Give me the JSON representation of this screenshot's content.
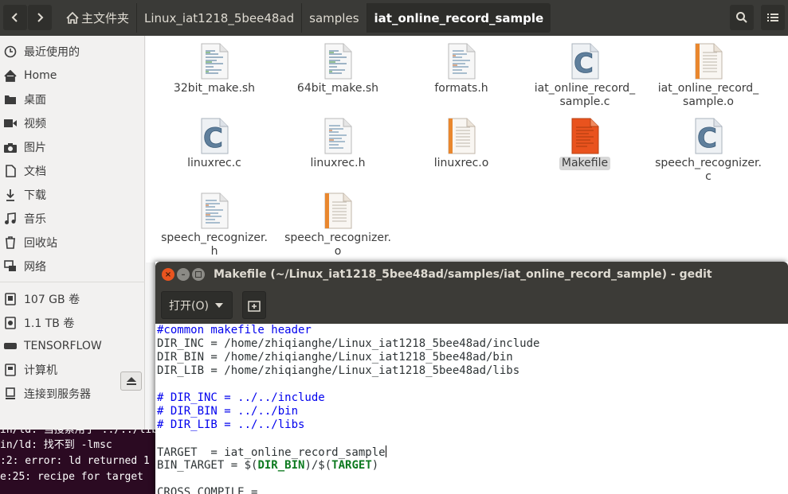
{
  "header": {
    "breadcrumbs": [
      {
        "label": "主文件夹"
      },
      {
        "label": "Linux_iat1218_5bee48ad"
      },
      {
        "label": "samples"
      },
      {
        "label": "iat_online_record_sample"
      }
    ]
  },
  "sidebar": {
    "items": [
      {
        "label": "最近使用的"
      },
      {
        "label": "Home"
      },
      {
        "label": "桌面"
      },
      {
        "label": "视频"
      },
      {
        "label": "图片"
      },
      {
        "label": "文档"
      },
      {
        "label": "下载"
      },
      {
        "label": "音乐"
      },
      {
        "label": "回收站"
      },
      {
        "label": "网络"
      }
    ],
    "devices": [
      {
        "label": "107 GB 卷"
      },
      {
        "label": "1.1 TB 卷"
      },
      {
        "label": "TENSORFLOW"
      },
      {
        "label": "计算机"
      },
      {
        "label": "连接到服务器"
      }
    ]
  },
  "files": [
    {
      "name": "32bit_make.sh",
      "type": "script"
    },
    {
      "name": "64bit_make.sh",
      "type": "script"
    },
    {
      "name": "formats.h",
      "type": "header"
    },
    {
      "name": "iat_online_record_\nsample.c",
      "type": "c"
    },
    {
      "name": "iat_online_record_\nsample.o",
      "type": "object"
    },
    {
      "name": "linuxrec.c",
      "type": "c"
    },
    {
      "name": "linuxrec.h",
      "type": "header"
    },
    {
      "name": "linuxrec.o",
      "type": "object"
    },
    {
      "name": "Makefile",
      "type": "makefile",
      "selected": true
    },
    {
      "name": "speech_recognizer.\nc",
      "type": "c"
    },
    {
      "name": "speech_recognizer.\nh",
      "type": "header"
    },
    {
      "name": "speech_recognizer.\no",
      "type": "object"
    }
  ],
  "terminal": {
    "lines": [
      "in/ld: 当搜索用于 ../../lib",
      "in/ld: 找不到 -lmsc",
      ":2: error: ld returned 1",
      "e:25: recipe for target"
    ]
  },
  "gedit": {
    "title": "Makefile (~/Linux_iat1218_5bee48ad/samples/iat_online_record_sample) - gedit",
    "open_label": "打开(O)",
    "lines": [
      {
        "text": "#common makefile header",
        "comment": true
      },
      {
        "text": "DIR_INC = /home/zhiqianghe/Linux_iat1218_5bee48ad/include"
      },
      {
        "text": "DIR_BIN = /home/zhiqianghe/Linux_iat1218_5bee48ad/bin"
      },
      {
        "text": "DIR_LIB = /home/zhiqianghe/Linux_iat1218_5bee48ad/libs"
      },
      {
        "text": ""
      },
      {
        "text": "# DIR_INC = ../../include",
        "comment": true
      },
      {
        "text": "# DIR_BIN = ../../bin",
        "comment": true
      },
      {
        "text": "# DIR_LIB = ../../libs",
        "comment": true
      },
      {
        "text": ""
      },
      {
        "text": "TARGET  = iat_online_record_sample",
        "cursor": true
      },
      {
        "text": "BIN_TARGET = $(DIR_BIN)/$(TARGET)",
        "vars": [
          "DIR_BIN",
          "TARGET"
        ]
      },
      {
        "text": ""
      },
      {
        "text": "CROSS_COMPILE = "
      }
    ]
  },
  "colors": {
    "accent_orange": "#e9531e",
    "comment_blue": "#0000ee",
    "variable_green": "#0d7a1f"
  }
}
